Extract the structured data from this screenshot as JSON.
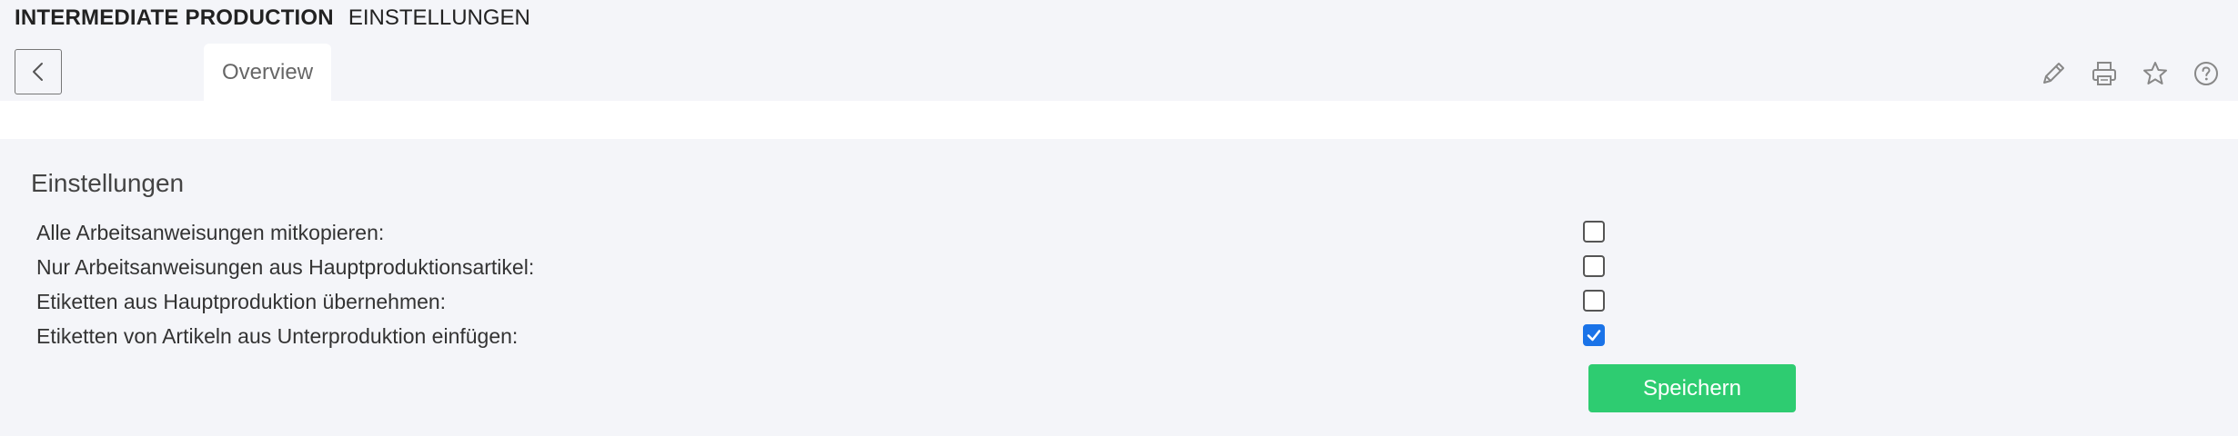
{
  "header": {
    "app_title": "INTERMEDIATE PRODUCTION",
    "page_subtitle": "EINSTELLUNGEN"
  },
  "tabs": [
    {
      "label": "Overview",
      "active": true
    }
  ],
  "toolbar": {
    "icons": [
      "pencil-icon",
      "printer-icon",
      "star-icon",
      "help-icon"
    ]
  },
  "settings": {
    "heading": "Einstellungen",
    "options": [
      {
        "label": "Alle Arbeitsanweisungen mitkopieren:",
        "checked": false
      },
      {
        "label": "Nur Arbeitsanweisungen aus Hauptproduktionsartikel:",
        "checked": false
      },
      {
        "label": "Etiketten aus Hauptproduktion übernehmen:",
        "checked": false
      },
      {
        "label": "Etiketten von Artikeln aus Unterproduktion einfügen:",
        "checked": true
      }
    ],
    "save_label": "Speichern"
  },
  "colors": {
    "accent_green": "#2ecc71",
    "checkbox_blue": "#1a73e8",
    "background": "#f4f5f9"
  }
}
